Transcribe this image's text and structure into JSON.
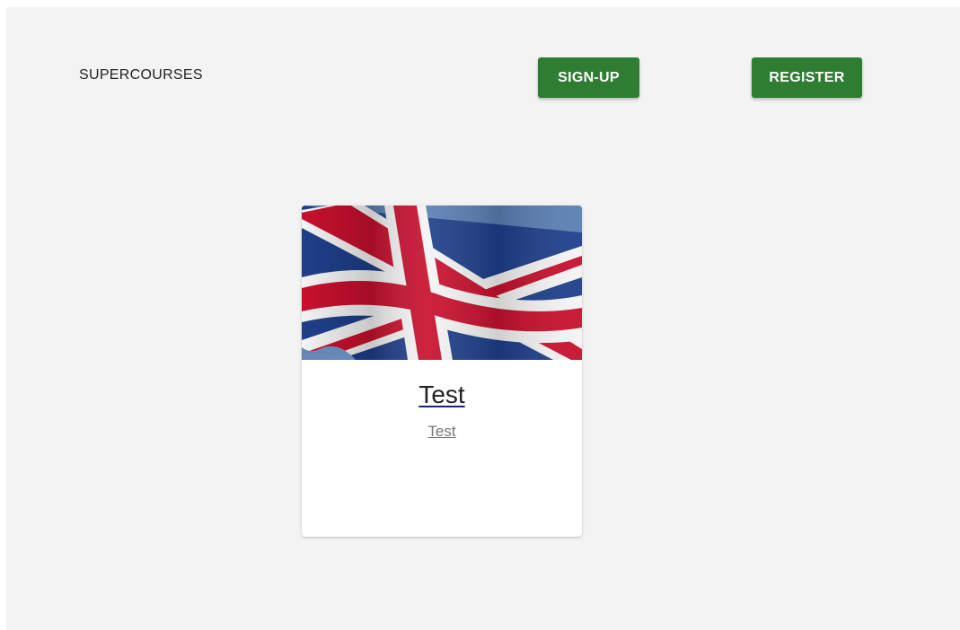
{
  "header": {
    "brand": "SUPERCOURSES",
    "signup_label": "SIGN-UP",
    "register_label": "REGISTER"
  },
  "courses": [
    {
      "title": "Test",
      "subtitle": "Test",
      "image": "uk-flag"
    }
  ],
  "colors": {
    "background": "#f3f3f3",
    "button": "#2e7d32",
    "card": "#ffffff",
    "flag_blue": "#1f3f8a",
    "flag_red": "#c8102e"
  }
}
